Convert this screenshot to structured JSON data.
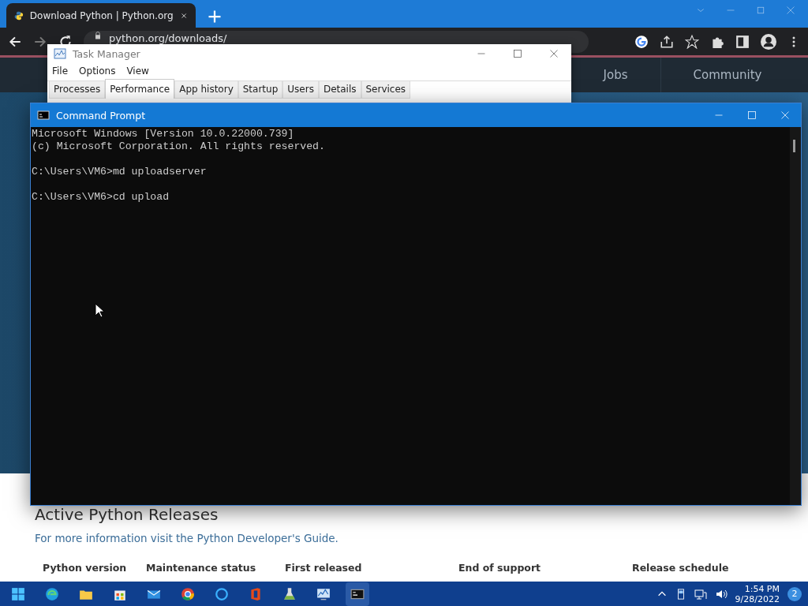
{
  "browser": {
    "tab_title": "Download Python | Python.org",
    "address": "python.org/downloads/",
    "nav": [
      "Jobs",
      "Community"
    ],
    "releases": {
      "heading": "Active Python Releases",
      "intro": "For more information visit the Python Developer's Guide.",
      "columns": [
        "Python version",
        "Maintenance status",
        "First released",
        "End of support",
        "Release schedule"
      ]
    }
  },
  "task_manager": {
    "title": "Task Manager",
    "menu": [
      "File",
      "Options",
      "View"
    ],
    "tabs": [
      {
        "label": "Processes",
        "selected": false
      },
      {
        "label": "Performance",
        "selected": true
      },
      {
        "label": "App history",
        "selected": false
      },
      {
        "label": "Startup",
        "selected": false
      },
      {
        "label": "Users",
        "selected": false
      },
      {
        "label": "Details",
        "selected": false
      },
      {
        "label": "Services",
        "selected": false
      }
    ]
  },
  "command_prompt": {
    "title": "Command Prompt",
    "blocks": [
      [
        "Microsoft Windows [Version 10.0.22000.739]",
        "(c) Microsoft Corporation. All rights reserved."
      ],
      [
        "C:\\Users\\VM6>md uploadserver"
      ],
      [
        "C:\\Users\\VM6>cd upload"
      ]
    ]
  },
  "taskbar": {
    "time": "1:54 PM",
    "date": "9/28/2022",
    "notifications": "2"
  }
}
